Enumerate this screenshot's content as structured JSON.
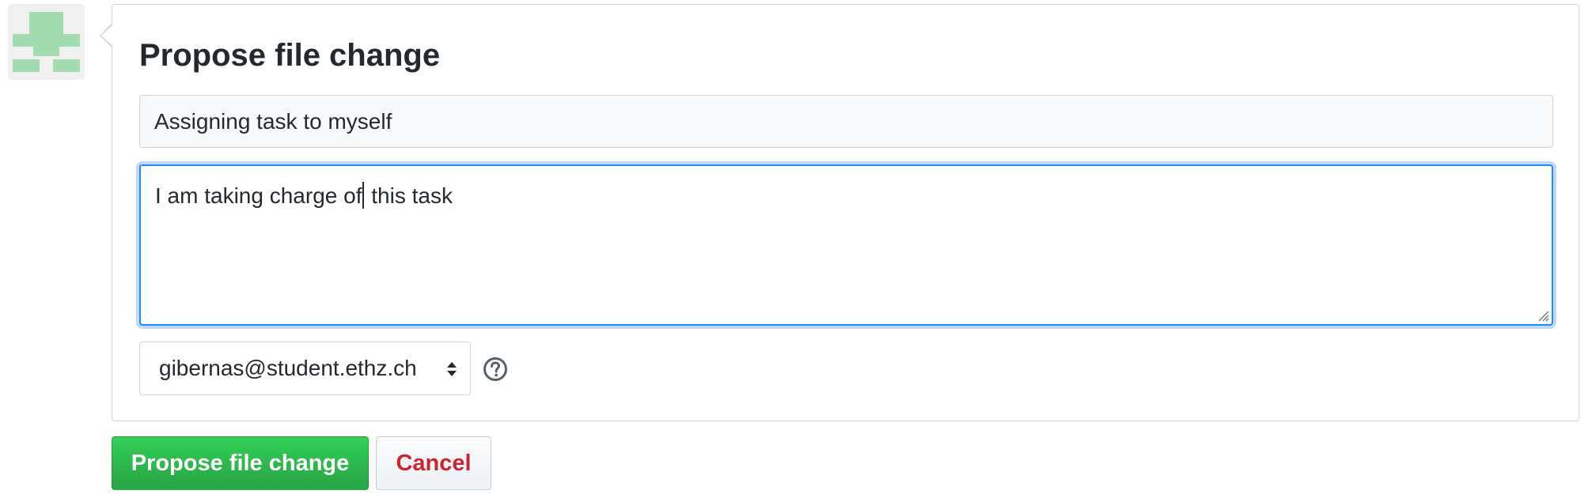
{
  "form": {
    "title": "Propose file change",
    "summary_value": "Assigning task to myself",
    "description_before_caret": "I am taking charge of",
    "description_after_caret": " this task",
    "email_selected": "gibernas@student.ethz.ch",
    "help_icon": "question-circle-icon",
    "avatar_icon": "identicon-avatar"
  },
  "actions": {
    "propose_label": "Propose file change",
    "cancel_label": "Cancel"
  },
  "colors": {
    "primary_button": "#28a745",
    "cancel_text": "#cb2431",
    "focus_border": "#2188ff",
    "identicon": "#a3dcae"
  }
}
